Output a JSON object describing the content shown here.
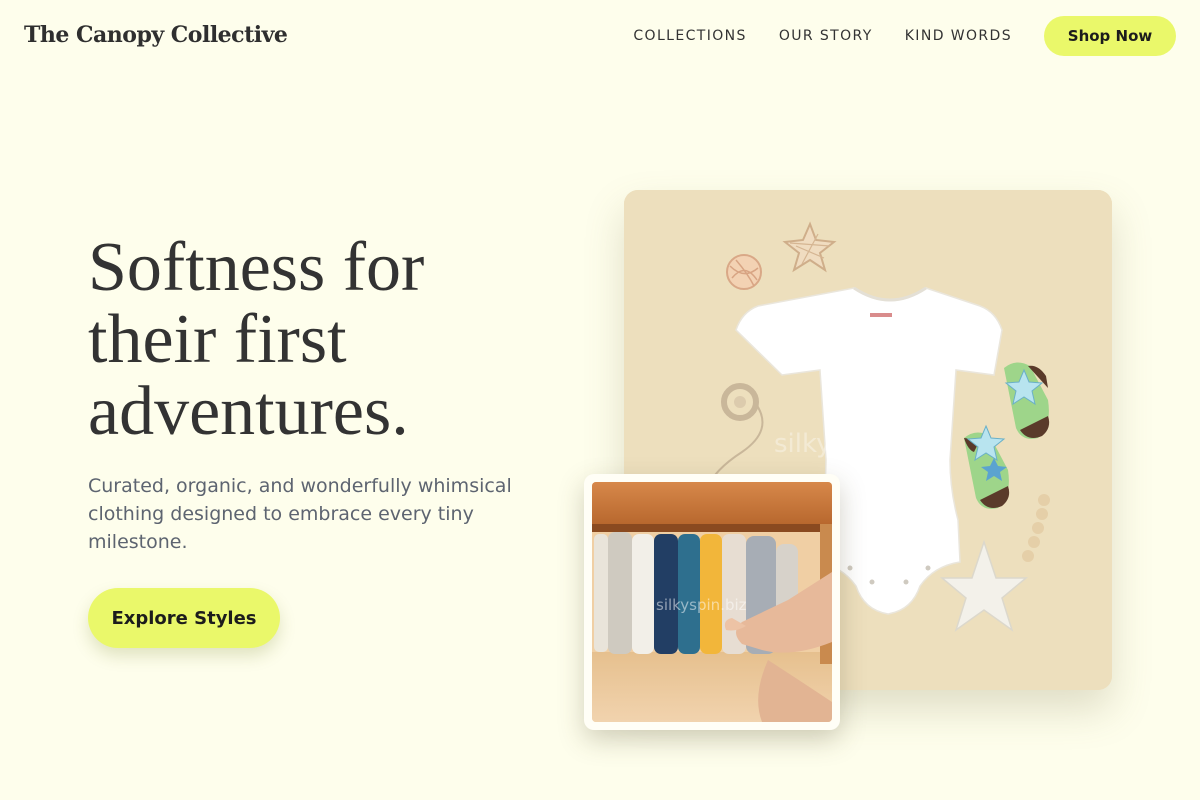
{
  "header": {
    "logo": "The Canopy Collective",
    "nav": [
      {
        "label": "COLLECTIONS"
      },
      {
        "label": "OUR STORY"
      },
      {
        "label": "KIND WORDS"
      }
    ],
    "cta_label": "Shop Now"
  },
  "hero": {
    "headline": "Softness for their first adventures.",
    "subtext": "Curated, organic, and wonderfully whimsical clothing designed to embrace every tiny milestone.",
    "button_label": "Explore Styles"
  },
  "images": {
    "main_watermark": "silkyspin.biz",
    "inset_watermark": "silkyspin.biz"
  },
  "colors": {
    "background": "#fefeec",
    "accent": "#eaf86a",
    "text": "#333333",
    "subtext": "#5d6470",
    "photo_backdrop": "#eddfbd"
  }
}
